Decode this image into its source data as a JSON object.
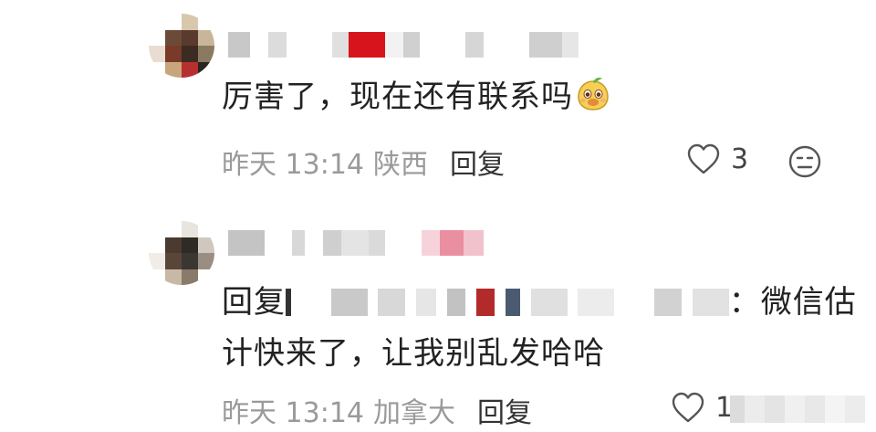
{
  "comments": [
    {
      "text": "厉害了，现在还有联系吗",
      "emoji": "mango-emoji",
      "time": "昨天 13:14",
      "location": "陕西",
      "reply_label": "回复",
      "like_count": "3"
    },
    {
      "reply_prefix": "回复",
      "text_part1": "：微信估",
      "text_part2": "计快来了，让我别乱发哈哈",
      "time": "昨天 13:14",
      "location": "加拿大",
      "reply_label": "回复",
      "like_count": "1"
    }
  ],
  "colors": {
    "meta_gray": "#9a9a9a",
    "text": "#222222",
    "icon_gray": "#555555"
  }
}
